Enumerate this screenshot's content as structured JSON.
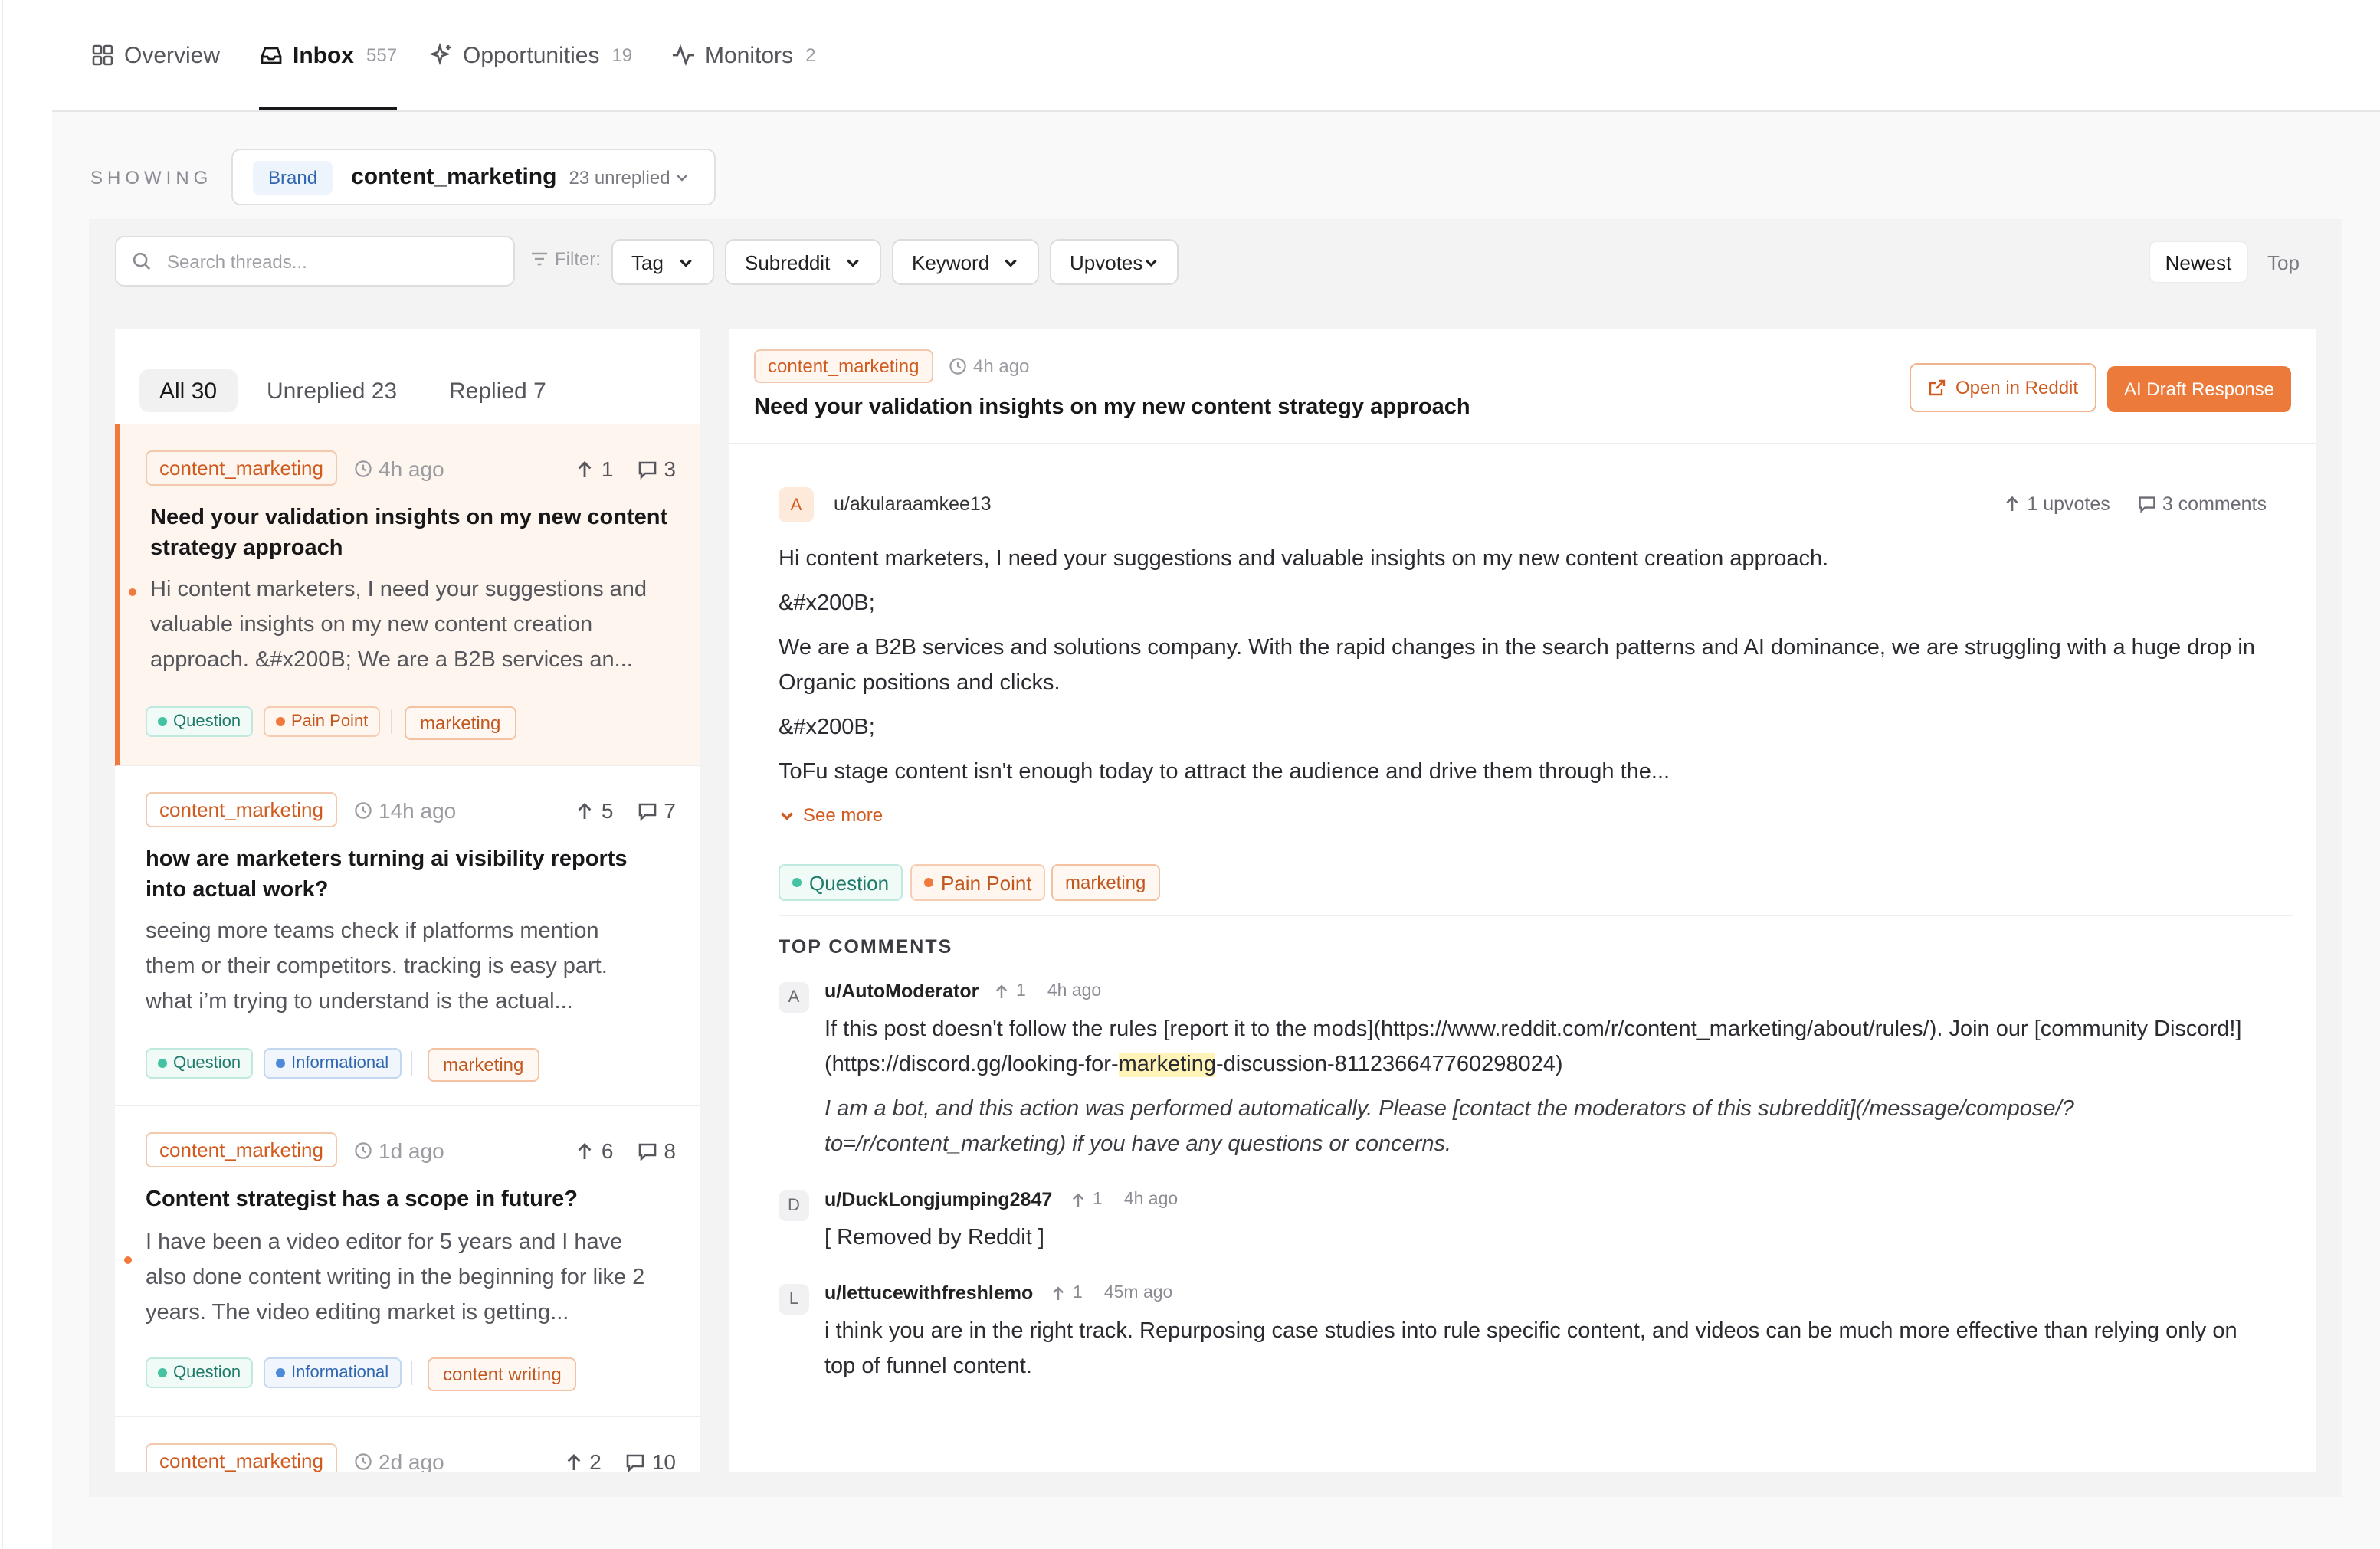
{
  "nav": {
    "tabs": [
      {
        "label": "Overview",
        "count": ""
      },
      {
        "label": "Inbox",
        "count": "557"
      },
      {
        "label": "Opportunities",
        "count": "19"
      },
      {
        "label": "Monitors",
        "count": "2"
      }
    ]
  },
  "showing": {
    "label": "SHOWING",
    "chip": "Brand",
    "name": "content_marketing",
    "unreplied": "23 unreplied"
  },
  "toolbar": {
    "search_placeholder": "Search threads...",
    "filter_label": "Filter:",
    "filters": [
      "Tag",
      "Subreddit",
      "Keyword",
      "Upvotes"
    ],
    "sort": [
      "Newest",
      "Top"
    ]
  },
  "list": {
    "tabs": [
      "All 30",
      "Unreplied 23",
      "Replied 7"
    ],
    "threads": [
      {
        "subreddit": "content_marketing",
        "time": "4h ago",
        "upvotes": "1",
        "comments": "3",
        "title": "Need your validation insights on my new content strategy approach",
        "excerpt": "Hi content marketers, I need your suggestions and valuable insights on my new content creation approach. &#x200B; We are a B2B services an...",
        "tags": [
          "Question",
          "Pain Point"
        ],
        "keyword": "marketing"
      },
      {
        "subreddit": "content_marketing",
        "time": "14h ago",
        "upvotes": "5",
        "comments": "7",
        "title": "how are marketers turning ai visibility reports into actual work?",
        "excerpt": "seeing more teams check if platforms mention them or their competitors. tracking is easy part. what i’m trying to understand is the actual...",
        "tags": [
          "Question",
          "Informational"
        ],
        "keyword": "marketing"
      },
      {
        "subreddit": "content_marketing",
        "time": "1d ago",
        "upvotes": "6",
        "comments": "8",
        "title": "Content strategist has a scope in future?",
        "excerpt": "I have been a video editor for 5 years and I have also done content writing in the beginning for like 2 years. The video editing market is getting...",
        "tags": [
          "Question",
          "Informational"
        ],
        "keyword": "content writing"
      },
      {
        "subreddit": "content_marketing",
        "time": "2d ago",
        "upvotes": "2",
        "comments": "10"
      }
    ]
  },
  "detail": {
    "subreddit": "content_marketing",
    "time": "4h ago",
    "title": "Need your validation insights on my new content strategy approach",
    "open_label": "Open in Reddit",
    "ai_label": "AI Draft Response",
    "avatar": "A",
    "author": "u/akularaamkee13",
    "upvotes": "1 upvotes",
    "comments": "3 comments",
    "paragraphs": [
      "Hi content marketers, I need your suggestions and valuable insights on my new content creation approach.",
      "&#x200B;",
      "We are a B2B services and solutions company. With the rapid changes in the search patterns and AI dominance, we are struggling with a huge drop in Organic positions and clicks.",
      "&#x200B;",
      "ToFu stage content isn't enough today to attract the audience and drive them through the..."
    ],
    "see_more": "See more",
    "tags": [
      "Question",
      "Pain Point"
    ],
    "keyword": "marketing",
    "top_comments_label": "TOP COMMENTS",
    "comments_list": [
      {
        "avatar": "A",
        "author": "u/AutoModerator",
        "upvotes": "1",
        "time": "4h ago",
        "text_before": "If this post doesn't follow the rules [report it to the mods](https://www.reddit.com/r/content_marketing/about/rules/). Join our [community Discord!](https://discord.gg/looking-for-",
        "text_highlight": "marketing",
        "text_after": "-discussion-811236647760298024)",
        "italic": "I am a bot, and this action was performed automatically. Please [contact the moderators of this subreddit](/message/compose/?to=/r/content_marketing) if you have any questions or concerns."
      },
      {
        "avatar": "D",
        "author": "u/DuckLongjumping2847",
        "upvotes": "1",
        "time": "4h ago",
        "text": "[ Removed by Reddit ]"
      },
      {
        "avatar": "L",
        "author": "u/lettucewithfreshlemo",
        "upvotes": "1",
        "time": "45m ago",
        "text": "i think you are in the right track. Repurposing case studies into rule specific content, and videos can be much more effective than relying only on top of funnel content."
      }
    ]
  }
}
